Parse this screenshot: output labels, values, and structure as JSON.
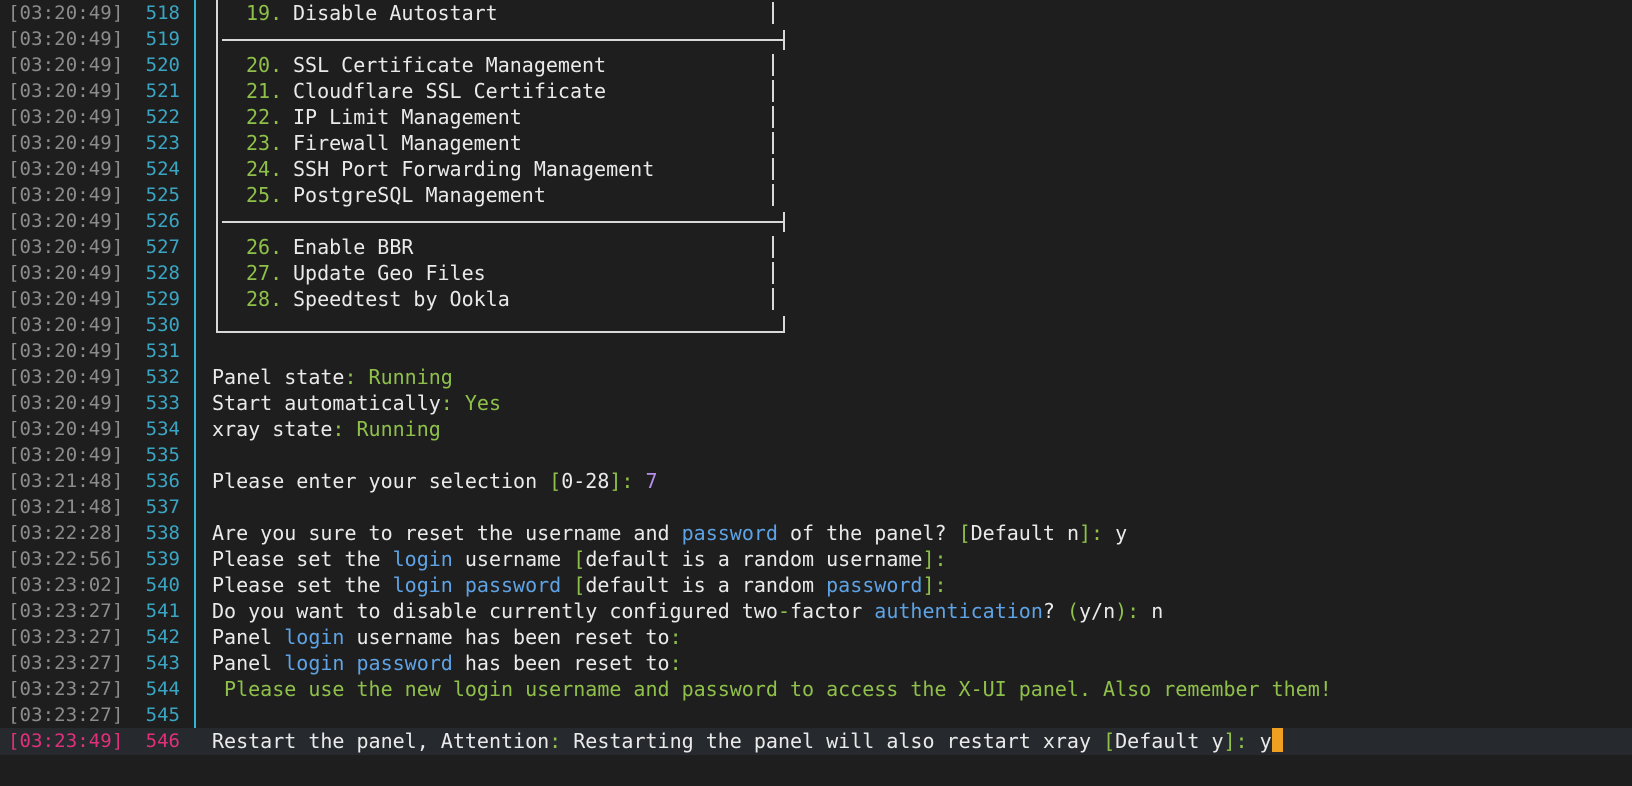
{
  "lines": [
    {
      "ts": "[03:20:49]",
      "num": "518",
      "kind": "menu",
      "item_num": "19.",
      "item_label": "Disable Autostart"
    },
    {
      "ts": "[03:20:49]",
      "num": "519",
      "kind": "divider"
    },
    {
      "ts": "[03:20:49]",
      "num": "520",
      "kind": "menu",
      "item_num": "20.",
      "item_label": "SSL Certificate Management"
    },
    {
      "ts": "[03:20:49]",
      "num": "521",
      "kind": "menu",
      "item_num": "21.",
      "item_label": "Cloudflare SSL Certificate"
    },
    {
      "ts": "[03:20:49]",
      "num": "522",
      "kind": "menu",
      "item_num": "22.",
      "item_label": "IP Limit Management"
    },
    {
      "ts": "[03:20:49]",
      "num": "523",
      "kind": "menu",
      "item_num": "23.",
      "item_label": "Firewall Management"
    },
    {
      "ts": "[03:20:49]",
      "num": "524",
      "kind": "menu",
      "item_num": "24.",
      "item_label": "SSH Port Forwarding Management"
    },
    {
      "ts": "[03:20:49]",
      "num": "525",
      "kind": "menu",
      "item_num": "25.",
      "item_label": "PostgreSQL Management"
    },
    {
      "ts": "[03:20:49]",
      "num": "526",
      "kind": "divider"
    },
    {
      "ts": "[03:20:49]",
      "num": "527",
      "kind": "menu",
      "item_num": "26.",
      "item_label": "Enable BBR"
    },
    {
      "ts": "[03:20:49]",
      "num": "528",
      "kind": "menu",
      "item_num": "27.",
      "item_label": "Update Geo Files"
    },
    {
      "ts": "[03:20:49]",
      "num": "529",
      "kind": "menu",
      "item_num": "28.",
      "item_label": "Speedtest by Ookla"
    },
    {
      "ts": "[03:20:49]",
      "num": "530",
      "kind": "box-bottom"
    },
    {
      "ts": "[03:20:49]",
      "num": "531",
      "kind": "blank"
    },
    {
      "ts": "[03:20:49]",
      "num": "532",
      "kind": "text",
      "segments": [
        {
          "text": "Panel state",
          "color": "white"
        },
        {
          "text": ": ",
          "color": "green"
        },
        {
          "text": "Running",
          "color": "green"
        }
      ]
    },
    {
      "ts": "[03:20:49]",
      "num": "533",
      "kind": "text",
      "segments": [
        {
          "text": "Start automatically",
          "color": "white"
        },
        {
          "text": ": ",
          "color": "green"
        },
        {
          "text": "Yes",
          "color": "green"
        }
      ]
    },
    {
      "ts": "[03:20:49]",
      "num": "534",
      "kind": "text",
      "segments": [
        {
          "text": "xray state",
          "color": "white"
        },
        {
          "text": ": ",
          "color": "green"
        },
        {
          "text": "Running",
          "color": "green"
        }
      ]
    },
    {
      "ts": "[03:20:49]",
      "num": "535",
      "kind": "blank"
    },
    {
      "ts": "[03:21:48]",
      "num": "536",
      "kind": "text",
      "segments": [
        {
          "text": "Please enter your selection ",
          "color": "white"
        },
        {
          "text": "[",
          "color": "green"
        },
        {
          "text": "0-28",
          "color": "white"
        },
        {
          "text": "]: ",
          "color": "green"
        },
        {
          "text": "7",
          "color": "purple"
        }
      ]
    },
    {
      "ts": "[03:21:48]",
      "num": "537",
      "kind": "blank"
    },
    {
      "ts": "[03:22:28]",
      "num": "538",
      "kind": "text",
      "segments": [
        {
          "text": "Are you sure to reset the username and ",
          "color": "white"
        },
        {
          "text": "password",
          "color": "blue"
        },
        {
          "text": " of the panel? ",
          "color": "white"
        },
        {
          "text": "[",
          "color": "green"
        },
        {
          "text": "Default n",
          "color": "white"
        },
        {
          "text": "]: ",
          "color": "green"
        },
        {
          "text": "y",
          "color": "white"
        }
      ]
    },
    {
      "ts": "[03:22:56]",
      "num": "539",
      "kind": "text",
      "segments": [
        {
          "text": "Please set the ",
          "color": "white"
        },
        {
          "text": "login",
          "color": "blue"
        },
        {
          "text": " username ",
          "color": "white"
        },
        {
          "text": "[",
          "color": "green"
        },
        {
          "text": "default is a random username",
          "color": "white"
        },
        {
          "text": "]:",
          "color": "green"
        }
      ]
    },
    {
      "ts": "[03:23:02]",
      "num": "540",
      "kind": "text",
      "segments": [
        {
          "text": "Please set the ",
          "color": "white"
        },
        {
          "text": "login",
          "color": "blue"
        },
        {
          "text": " ",
          "color": "white"
        },
        {
          "text": "password",
          "color": "blue"
        },
        {
          "text": " ",
          "color": "white"
        },
        {
          "text": "[",
          "color": "green"
        },
        {
          "text": "default is a random ",
          "color": "white"
        },
        {
          "text": "password",
          "color": "blue"
        },
        {
          "text": "]:",
          "color": "green"
        }
      ]
    },
    {
      "ts": "[03:23:27]",
      "num": "541",
      "kind": "text",
      "segments": [
        {
          "text": "Do you want to disable currently configured two",
          "color": "white"
        },
        {
          "text": "-",
          "color": "green"
        },
        {
          "text": "factor ",
          "color": "white"
        },
        {
          "text": "authentication",
          "color": "blue"
        },
        {
          "text": "? ",
          "color": "white"
        },
        {
          "text": "(",
          "color": "green"
        },
        {
          "text": "y/n",
          "color": "white"
        },
        {
          "text": "): ",
          "color": "green"
        },
        {
          "text": "n",
          "color": "white"
        }
      ]
    },
    {
      "ts": "[03:23:27]",
      "num": "542",
      "kind": "text",
      "segments": [
        {
          "text": "Panel ",
          "color": "white"
        },
        {
          "text": "login",
          "color": "blue"
        },
        {
          "text": " username has been reset to",
          "color": "white"
        },
        {
          "text": ":",
          "color": "green"
        }
      ]
    },
    {
      "ts": "[03:23:27]",
      "num": "543",
      "kind": "text",
      "segments": [
        {
          "text": "Panel ",
          "color": "white"
        },
        {
          "text": "login",
          "color": "blue"
        },
        {
          "text": " ",
          "color": "white"
        },
        {
          "text": "password",
          "color": "blue"
        },
        {
          "text": " has been reset to",
          "color": "white"
        },
        {
          "text": ":",
          "color": "green"
        }
      ]
    },
    {
      "ts": "[03:23:27]",
      "num": "544",
      "kind": "text",
      "segments": [
        {
          "text": " Please use the new login username and password to access the X-UI panel. Also remember them!",
          "color": "green"
        }
      ]
    },
    {
      "ts": "[03:23:27]",
      "num": "545",
      "kind": "blank"
    },
    {
      "ts": "[03:23:49]",
      "num": "546",
      "kind": "text",
      "current": true,
      "segments": [
        {
          "text": "Restart the panel, Attention",
          "color": "white"
        },
        {
          "text": ": ",
          "color": "green"
        },
        {
          "text": "Restarting the panel will also restart xray ",
          "color": "white"
        },
        {
          "text": "[",
          "color": "green"
        },
        {
          "text": "Default y",
          "color": "white"
        },
        {
          "text": "]: ",
          "color": "green"
        },
        {
          "text": "y",
          "color": "white"
        }
      ]
    }
  ],
  "colors": {
    "background": "#1e1e1e",
    "timestamp": "#8c8c8c",
    "line_number": "#3aa6c4",
    "current_line_accent": "#e0307a",
    "menu_number": "#8fc04a",
    "keyword_blue": "#5ea3e6",
    "input_purple": "#b48ee8",
    "cursor": "#f0a020"
  }
}
